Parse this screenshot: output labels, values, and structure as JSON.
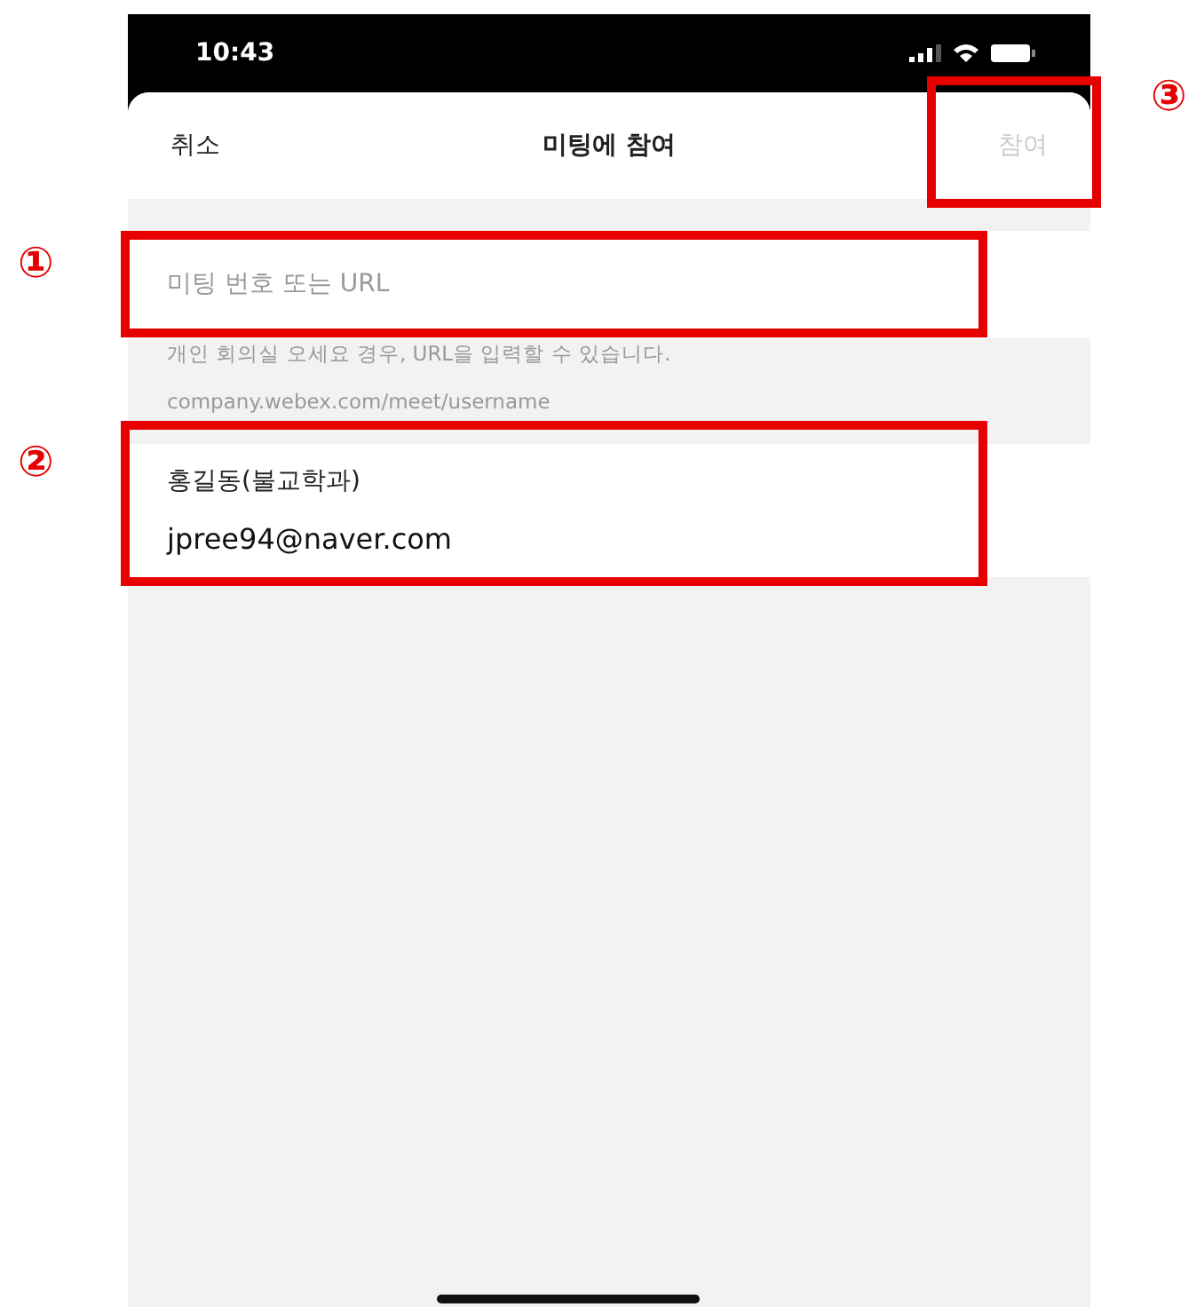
{
  "status_bar": {
    "time": "10:43"
  },
  "header": {
    "cancel": "취소",
    "title": "미팅에 참여",
    "join": "참여",
    "join_disabled": true
  },
  "meeting_field": {
    "placeholder": "미팅 번호 또는 URL"
  },
  "hint": [
    "개인 회의실 오세요 경우, URL을 입력할 수 있습니다.",
    "company.webex.com/meet/username"
  ],
  "user": {
    "name": "홍길동(불교학과)",
    "email": "jpree94@naver.com"
  },
  "annotations": [
    {
      "label": "①",
      "kind": "field"
    },
    {
      "label": "②",
      "kind": "user"
    },
    {
      "label": "③",
      "kind": "join"
    }
  ]
}
